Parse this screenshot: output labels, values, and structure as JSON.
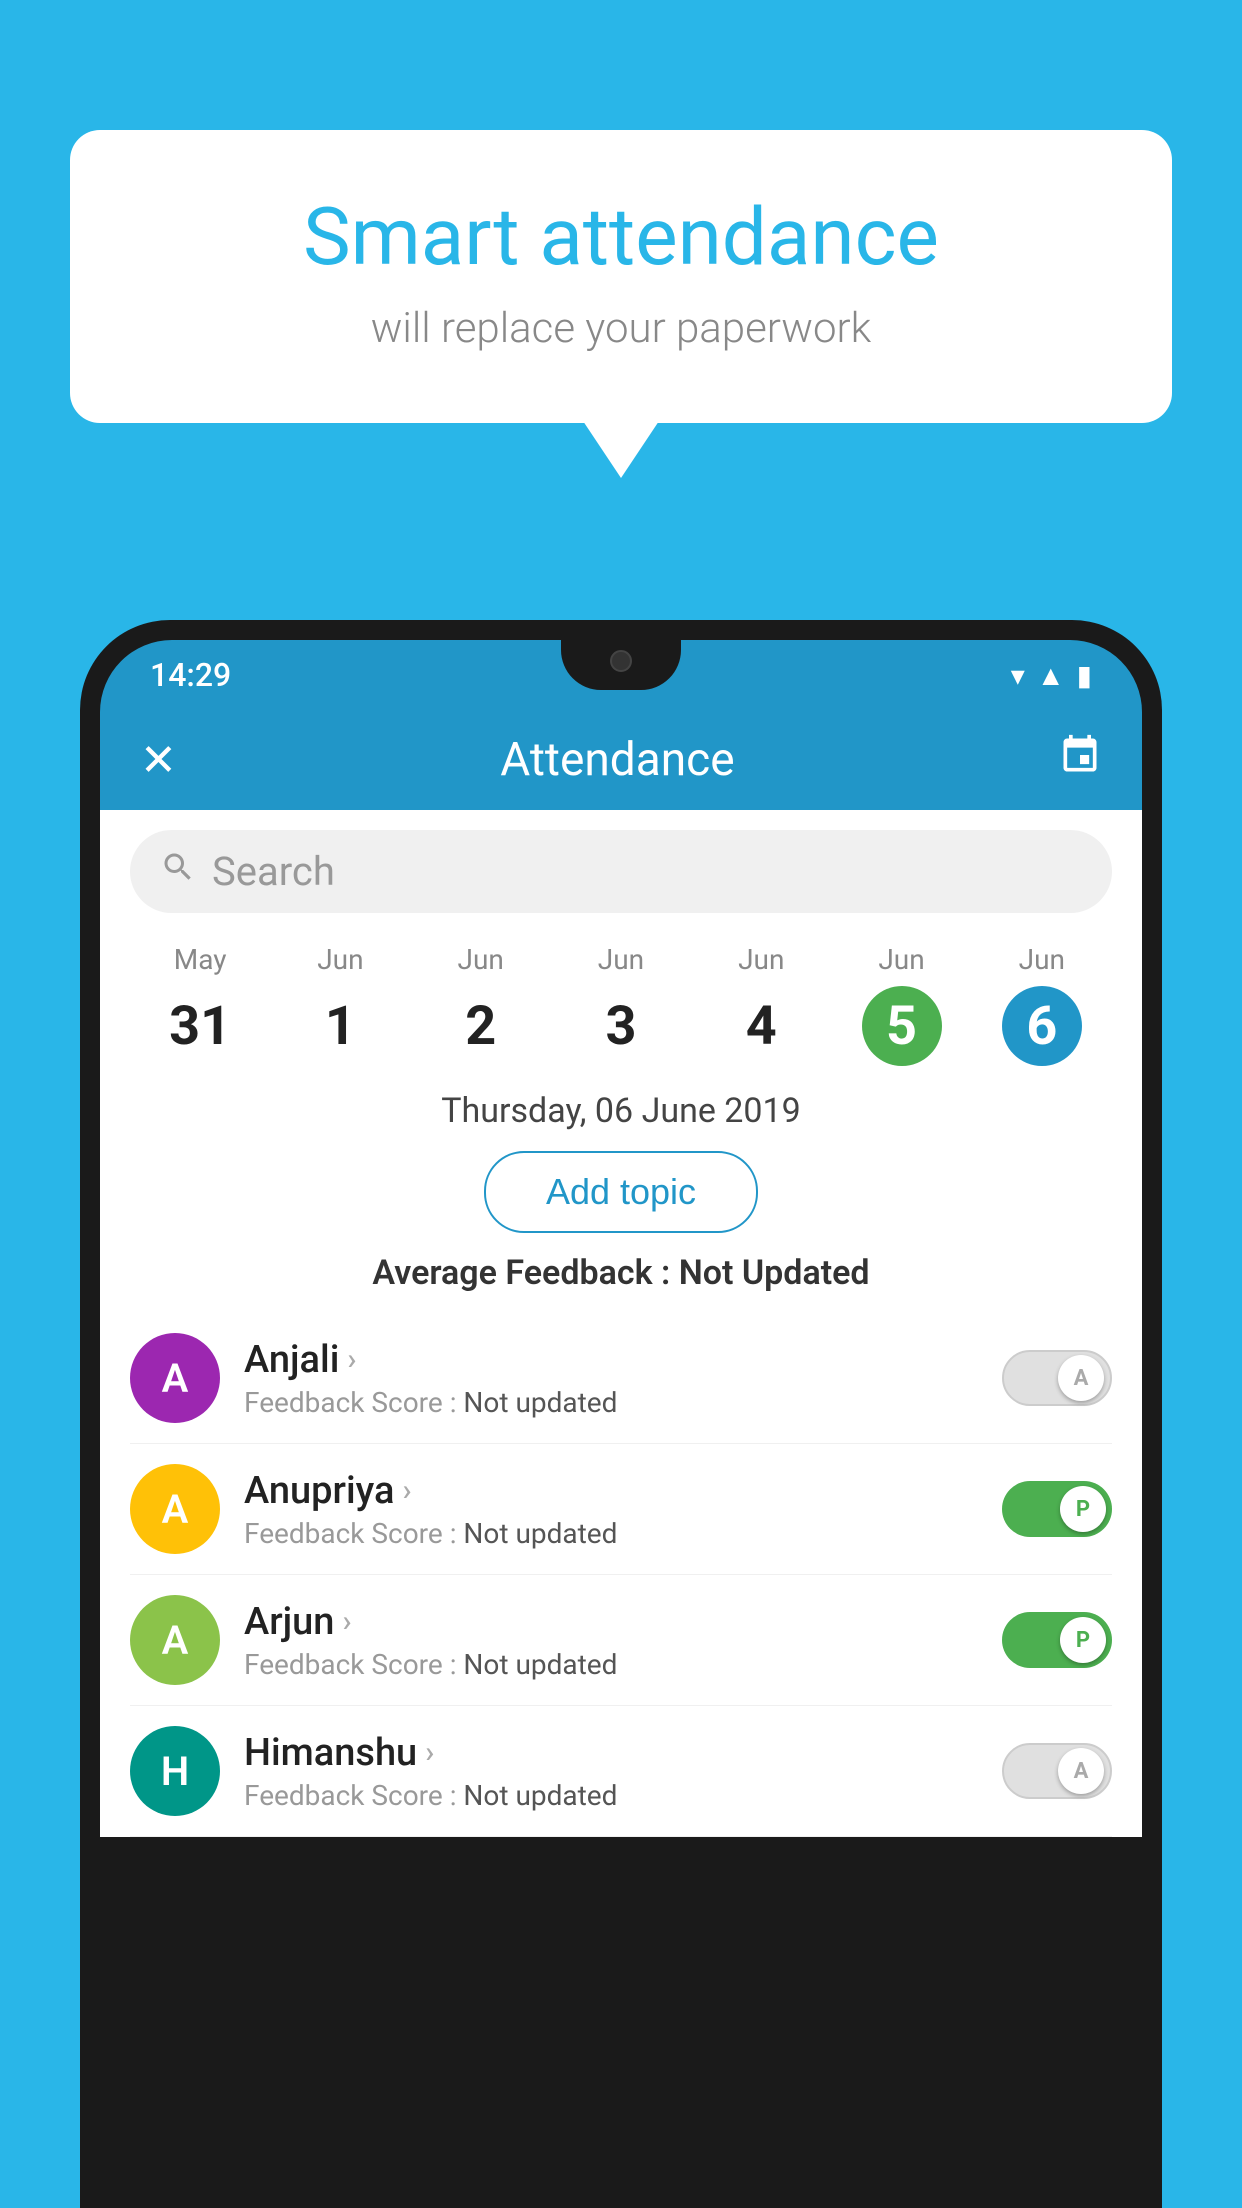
{
  "background_color": "#29b6e8",
  "bubble": {
    "title": "Smart attendance",
    "subtitle": "will replace your paperwork"
  },
  "status_bar": {
    "time": "14:29",
    "icons": [
      "wifi",
      "signal",
      "battery"
    ]
  },
  "header": {
    "title": "Attendance",
    "close_label": "✕",
    "calendar_label": "📅"
  },
  "search": {
    "placeholder": "Search"
  },
  "calendar": {
    "days": [
      {
        "month": "May",
        "date": "31",
        "state": "normal"
      },
      {
        "month": "Jun",
        "date": "1",
        "state": "normal"
      },
      {
        "month": "Jun",
        "date": "2",
        "state": "normal"
      },
      {
        "month": "Jun",
        "date": "3",
        "state": "normal"
      },
      {
        "month": "Jun",
        "date": "4",
        "state": "normal"
      },
      {
        "month": "Jun",
        "date": "5",
        "state": "today"
      },
      {
        "month": "Jun",
        "date": "6",
        "state": "selected"
      }
    ]
  },
  "selected_date": "Thursday, 06 June 2019",
  "add_topic_label": "Add topic",
  "avg_feedback_label": "Average Feedback :",
  "avg_feedback_value": "Not Updated",
  "students": [
    {
      "name": "Anjali",
      "initials": "A",
      "avatar_color": "avatar-purple",
      "feedback_label": "Feedback Score :",
      "feedback_value": "Not updated",
      "toggle": "off",
      "toggle_label": "A"
    },
    {
      "name": "Anupriya",
      "initials": "A",
      "avatar_color": "avatar-amber",
      "feedback_label": "Feedback Score :",
      "feedback_value": "Not updated",
      "toggle": "on",
      "toggle_label": "P"
    },
    {
      "name": "Arjun",
      "initials": "A",
      "avatar_color": "avatar-green",
      "feedback_label": "Feedback Score :",
      "feedback_value": "Not updated",
      "toggle": "on",
      "toggle_label": "P"
    },
    {
      "name": "Himanshu",
      "initials": "H",
      "avatar_color": "avatar-teal",
      "feedback_label": "Feedback Score :",
      "feedback_value": "Not updated",
      "toggle": "off",
      "toggle_label": "A"
    }
  ]
}
